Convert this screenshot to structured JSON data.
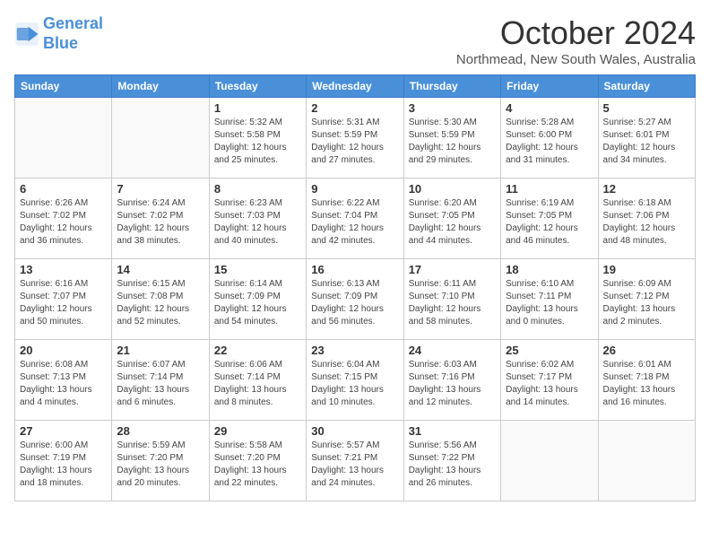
{
  "header": {
    "logo": {
      "line1": "General",
      "line2": "Blue"
    },
    "title": "October 2024",
    "location": "Northmead, New South Wales, Australia"
  },
  "weekdays": [
    "Sunday",
    "Monday",
    "Tuesday",
    "Wednesday",
    "Thursday",
    "Friday",
    "Saturday"
  ],
  "weeks": [
    [
      {
        "day": "",
        "sunrise": "",
        "sunset": "",
        "daylight": ""
      },
      {
        "day": "",
        "sunrise": "",
        "sunset": "",
        "daylight": ""
      },
      {
        "day": "1",
        "sunrise": "Sunrise: 5:32 AM",
        "sunset": "Sunset: 5:58 PM",
        "daylight": "Daylight: 12 hours and 25 minutes."
      },
      {
        "day": "2",
        "sunrise": "Sunrise: 5:31 AM",
        "sunset": "Sunset: 5:59 PM",
        "daylight": "Daylight: 12 hours and 27 minutes."
      },
      {
        "day": "3",
        "sunrise": "Sunrise: 5:30 AM",
        "sunset": "Sunset: 5:59 PM",
        "daylight": "Daylight: 12 hours and 29 minutes."
      },
      {
        "day": "4",
        "sunrise": "Sunrise: 5:28 AM",
        "sunset": "Sunset: 6:00 PM",
        "daylight": "Daylight: 12 hours and 31 minutes."
      },
      {
        "day": "5",
        "sunrise": "Sunrise: 5:27 AM",
        "sunset": "Sunset: 6:01 PM",
        "daylight": "Daylight: 12 hours and 34 minutes."
      }
    ],
    [
      {
        "day": "6",
        "sunrise": "Sunrise: 6:26 AM",
        "sunset": "Sunset: 7:02 PM",
        "daylight": "Daylight: 12 hours and 36 minutes."
      },
      {
        "day": "7",
        "sunrise": "Sunrise: 6:24 AM",
        "sunset": "Sunset: 7:02 PM",
        "daylight": "Daylight: 12 hours and 38 minutes."
      },
      {
        "day": "8",
        "sunrise": "Sunrise: 6:23 AM",
        "sunset": "Sunset: 7:03 PM",
        "daylight": "Daylight: 12 hours and 40 minutes."
      },
      {
        "day": "9",
        "sunrise": "Sunrise: 6:22 AM",
        "sunset": "Sunset: 7:04 PM",
        "daylight": "Daylight: 12 hours and 42 minutes."
      },
      {
        "day": "10",
        "sunrise": "Sunrise: 6:20 AM",
        "sunset": "Sunset: 7:05 PM",
        "daylight": "Daylight: 12 hours and 44 minutes."
      },
      {
        "day": "11",
        "sunrise": "Sunrise: 6:19 AM",
        "sunset": "Sunset: 7:05 PM",
        "daylight": "Daylight: 12 hours and 46 minutes."
      },
      {
        "day": "12",
        "sunrise": "Sunrise: 6:18 AM",
        "sunset": "Sunset: 7:06 PM",
        "daylight": "Daylight: 12 hours and 48 minutes."
      }
    ],
    [
      {
        "day": "13",
        "sunrise": "Sunrise: 6:16 AM",
        "sunset": "Sunset: 7:07 PM",
        "daylight": "Daylight: 12 hours and 50 minutes."
      },
      {
        "day": "14",
        "sunrise": "Sunrise: 6:15 AM",
        "sunset": "Sunset: 7:08 PM",
        "daylight": "Daylight: 12 hours and 52 minutes."
      },
      {
        "day": "15",
        "sunrise": "Sunrise: 6:14 AM",
        "sunset": "Sunset: 7:09 PM",
        "daylight": "Daylight: 12 hours and 54 minutes."
      },
      {
        "day": "16",
        "sunrise": "Sunrise: 6:13 AM",
        "sunset": "Sunset: 7:09 PM",
        "daylight": "Daylight: 12 hours and 56 minutes."
      },
      {
        "day": "17",
        "sunrise": "Sunrise: 6:11 AM",
        "sunset": "Sunset: 7:10 PM",
        "daylight": "Daylight: 12 hours and 58 minutes."
      },
      {
        "day": "18",
        "sunrise": "Sunrise: 6:10 AM",
        "sunset": "Sunset: 7:11 PM",
        "daylight": "Daylight: 13 hours and 0 minutes."
      },
      {
        "day": "19",
        "sunrise": "Sunrise: 6:09 AM",
        "sunset": "Sunset: 7:12 PM",
        "daylight": "Daylight: 13 hours and 2 minutes."
      }
    ],
    [
      {
        "day": "20",
        "sunrise": "Sunrise: 6:08 AM",
        "sunset": "Sunset: 7:13 PM",
        "daylight": "Daylight: 13 hours and 4 minutes."
      },
      {
        "day": "21",
        "sunrise": "Sunrise: 6:07 AM",
        "sunset": "Sunset: 7:14 PM",
        "daylight": "Daylight: 13 hours and 6 minutes."
      },
      {
        "day": "22",
        "sunrise": "Sunrise: 6:06 AM",
        "sunset": "Sunset: 7:14 PM",
        "daylight": "Daylight: 13 hours and 8 minutes."
      },
      {
        "day": "23",
        "sunrise": "Sunrise: 6:04 AM",
        "sunset": "Sunset: 7:15 PM",
        "daylight": "Daylight: 13 hours and 10 minutes."
      },
      {
        "day": "24",
        "sunrise": "Sunrise: 6:03 AM",
        "sunset": "Sunset: 7:16 PM",
        "daylight": "Daylight: 13 hours and 12 minutes."
      },
      {
        "day": "25",
        "sunrise": "Sunrise: 6:02 AM",
        "sunset": "Sunset: 7:17 PM",
        "daylight": "Daylight: 13 hours and 14 minutes."
      },
      {
        "day": "26",
        "sunrise": "Sunrise: 6:01 AM",
        "sunset": "Sunset: 7:18 PM",
        "daylight": "Daylight: 13 hours and 16 minutes."
      }
    ],
    [
      {
        "day": "27",
        "sunrise": "Sunrise: 6:00 AM",
        "sunset": "Sunset: 7:19 PM",
        "daylight": "Daylight: 13 hours and 18 minutes."
      },
      {
        "day": "28",
        "sunrise": "Sunrise: 5:59 AM",
        "sunset": "Sunset: 7:20 PM",
        "daylight": "Daylight: 13 hours and 20 minutes."
      },
      {
        "day": "29",
        "sunrise": "Sunrise: 5:58 AM",
        "sunset": "Sunset: 7:20 PM",
        "daylight": "Daylight: 13 hours and 22 minutes."
      },
      {
        "day": "30",
        "sunrise": "Sunrise: 5:57 AM",
        "sunset": "Sunset: 7:21 PM",
        "daylight": "Daylight: 13 hours and 24 minutes."
      },
      {
        "day": "31",
        "sunrise": "Sunrise: 5:56 AM",
        "sunset": "Sunset: 7:22 PM",
        "daylight": "Daylight: 13 hours and 26 minutes."
      },
      {
        "day": "",
        "sunrise": "",
        "sunset": "",
        "daylight": ""
      },
      {
        "day": "",
        "sunrise": "",
        "sunset": "",
        "daylight": ""
      }
    ]
  ]
}
